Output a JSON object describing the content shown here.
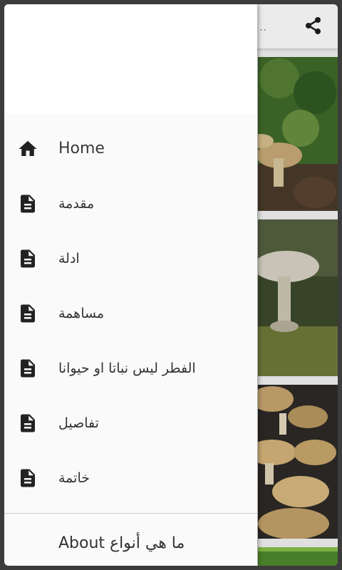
{
  "appbar": {
    "title_stub": "..",
    "share_icon": "share-icon"
  },
  "drawer": {
    "items": [
      {
        "label": "Home",
        "icon": "home-icon"
      },
      {
        "label": "مقدمة",
        "icon": "document-icon"
      },
      {
        "label": "ادلة",
        "icon": "document-icon"
      },
      {
        "label": "مساهمة",
        "icon": "document-icon"
      },
      {
        "label": "الفطر ليس نباتا او حيوانا",
        "icon": "document-icon"
      },
      {
        "label": "تفاصيل",
        "icon": "document-icon"
      },
      {
        "label": "خاتمة",
        "icon": "document-icon"
      }
    ],
    "about": "About ما هي أنواع"
  },
  "colors": {
    "icon": "#222222",
    "drawer_bg": "#fafafa",
    "text": "#333333"
  }
}
